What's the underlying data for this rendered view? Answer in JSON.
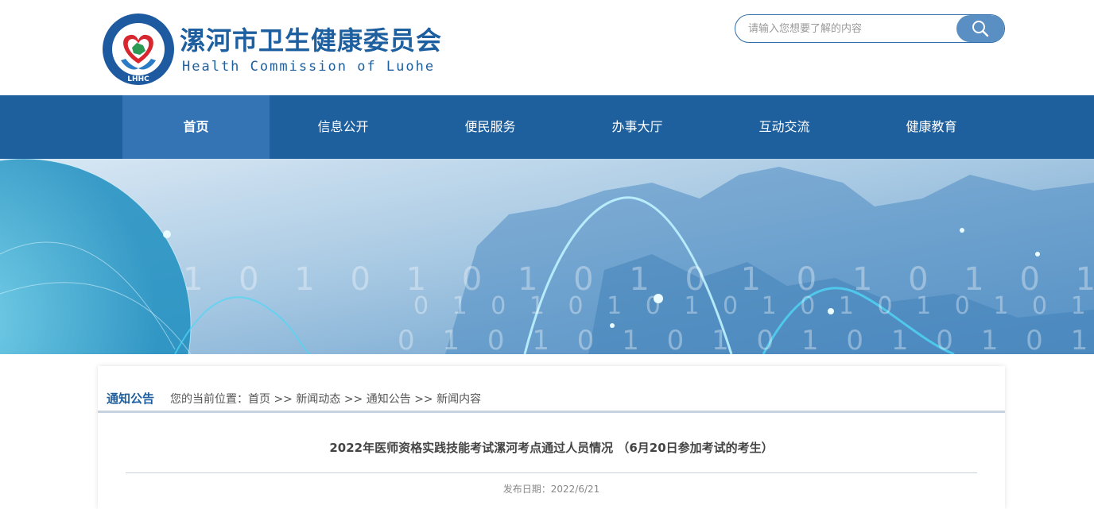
{
  "header": {
    "logo_letters": "LHHC",
    "title": "漯河市卫生健康委员会",
    "subtitle": "Health Commission of Luohe"
  },
  "search": {
    "placeholder": "请输入您想要了解的内容",
    "icon": "search-icon"
  },
  "nav": {
    "items": [
      {
        "label": "首页",
        "active": true
      },
      {
        "label": "信息公开"
      },
      {
        "label": "便民服务"
      },
      {
        "label": "办事大厅"
      },
      {
        "label": "互动交流"
      },
      {
        "label": "健康教育"
      }
    ]
  },
  "content": {
    "section_label": "通知公告",
    "breadcrumb_prefix": "您的当前位置：",
    "breadcrumb": [
      "首页",
      "新闻动态",
      "通知公告",
      "新闻内容"
    ],
    "breadcrumb_sep": ">>",
    "article_title": "2022年医师资格实践技能考试漯河考点通过人员情况 （6月20日参加考试的考生）",
    "publish_date": "发布日期：2022/6/21"
  },
  "colors": {
    "brand_blue": "#1d5f9f",
    "nav_bg": "#1e5f9e",
    "nav_active": "#3473b4",
    "search_button": "#5a8fc3"
  }
}
